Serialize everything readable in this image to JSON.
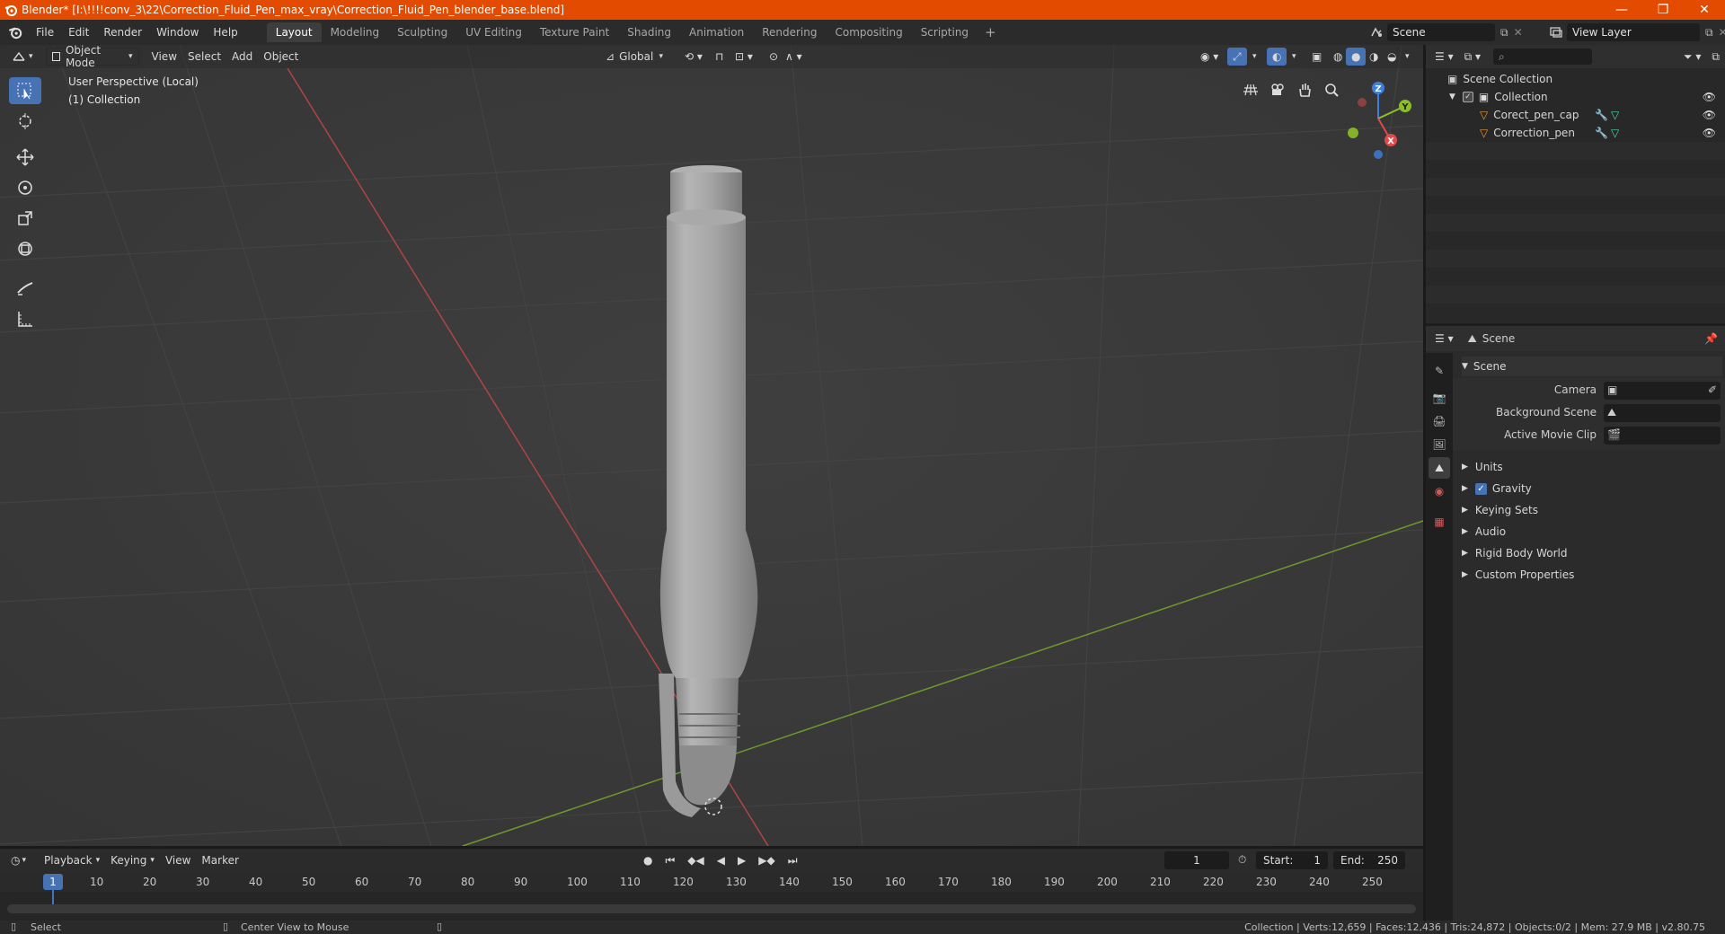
{
  "window": {
    "title": "Blender* [I:\\!!!!conv_3\\22\\Correction_Fluid_Pen_max_vray\\Correction_Fluid_Pen_blender_base.blend]",
    "minimize": "—",
    "maximize": "❐",
    "close": "✕"
  },
  "menu": [
    "File",
    "Edit",
    "Render",
    "Window",
    "Help"
  ],
  "workspaces": [
    "Layout",
    "Modeling",
    "Sculpting",
    "UV Editing",
    "Texture Paint",
    "Shading",
    "Animation",
    "Rendering",
    "Compositing",
    "Scripting"
  ],
  "workspace_add": "+",
  "scene_name": "Scene",
  "view_layer": "View Layer",
  "viewport": {
    "mode": "Object Mode",
    "menus": [
      "View",
      "Select",
      "Add",
      "Object"
    ],
    "orientation": "Global",
    "info_line1": "User Perspective (Local)",
    "info_line2": "(1) Collection",
    "gizmo": {
      "x": "X",
      "y": "Y",
      "z": "Z"
    }
  },
  "outliner": {
    "root": "Scene Collection",
    "collection": "Collection",
    "objects": [
      "Corect_pen_cap",
      "Correction_pen"
    ]
  },
  "properties": {
    "header": "Scene",
    "panel": "Scene",
    "fields": {
      "camera": "Camera",
      "background_scene": "Background Scene",
      "active_movie_clip": "Active Movie Clip"
    },
    "sections": [
      "Units",
      "Gravity",
      "Keying Sets",
      "Audio",
      "Rigid Body World",
      "Custom Properties"
    ]
  },
  "timeline": {
    "menus": [
      "Playback",
      "Keying",
      "View",
      "Marker"
    ],
    "current_frame": "1",
    "start_label": "Start:",
    "start": "1",
    "end_label": "End:",
    "end": "250",
    "ruler": [
      "10",
      "20",
      "30",
      "40",
      "50",
      "60",
      "70",
      "80",
      "90",
      "100",
      "110",
      "120",
      "130",
      "140",
      "150",
      "160",
      "170",
      "180",
      "190",
      "200",
      "210",
      "220",
      "230",
      "240",
      "250"
    ],
    "playhead": "1"
  },
  "status": {
    "left1": "Select",
    "left2": "Center View to Mouse",
    "right": "Collection | Verts:12,659 | Faces:12,436 | Tris:24,872 | Objects:0/2 | Mem: 27.9 MB | v2.80.75"
  },
  "colors": {
    "titlebar": "#e34c00",
    "accent": "#4772b3",
    "axis_x": "#e14a4a",
    "axis_y": "#8cbf26",
    "axis_z": "#3d7fe0"
  }
}
